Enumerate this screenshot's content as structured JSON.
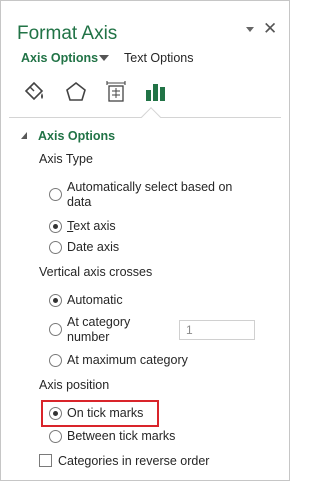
{
  "pane": {
    "title": "Format Axis",
    "dropdown_icon": "chevron-down-icon",
    "close_icon": "close-icon",
    "close_glyph": "✕"
  },
  "tabs": {
    "active": "Axis Options",
    "other": "Text Options"
  },
  "icon_row": [
    {
      "name": "fill-line-icon"
    },
    {
      "name": "effects-icon"
    },
    {
      "name": "size-properties-icon"
    },
    {
      "name": "axis-options-icon"
    }
  ],
  "section": {
    "title": "Axis Options"
  },
  "axis_type": {
    "label": "Axis Type",
    "options": [
      {
        "label_line1": "Automatically select based on",
        "label_line2": "data",
        "selected": false
      },
      {
        "label_prefix": "",
        "label_u": "T",
        "label_rest": "ext axis",
        "selected": true
      },
      {
        "label": "Date axis",
        "selected": false
      }
    ]
  },
  "vertical_crosses": {
    "label": "Vertical axis crosses",
    "options": [
      {
        "label": "Automatic",
        "selected": true
      },
      {
        "label_line1": "At category",
        "label_line2": "number",
        "selected": false,
        "value": "1"
      },
      {
        "label": "At maximum category",
        "selected": false
      }
    ]
  },
  "axis_position": {
    "label": "Axis position",
    "options": [
      {
        "label": "On tick marks",
        "selected": true,
        "highlighted": true
      },
      {
        "label": "Between tick marks",
        "selected": false
      }
    ]
  },
  "reverse": {
    "label": "Categories in reverse order",
    "checked": false
  },
  "colors": {
    "accent": "#217346",
    "highlight_border": "#d9242a"
  }
}
